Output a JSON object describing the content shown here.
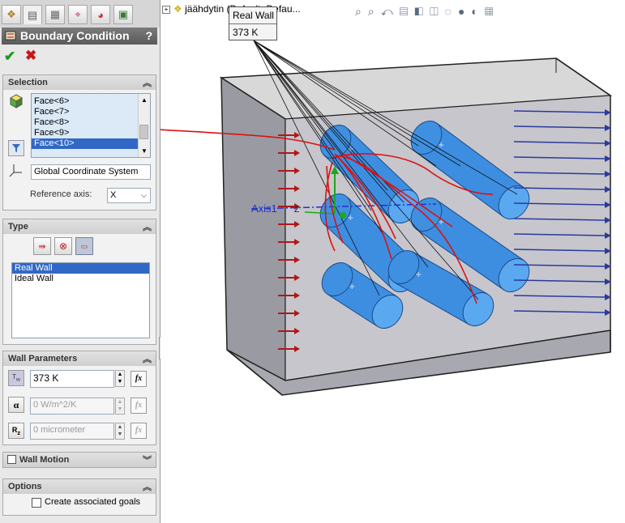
{
  "panel": {
    "title": "Boundary Condition",
    "help": "?",
    "tabs": [
      "feature-manager",
      "property-manager",
      "configuration-manager",
      "dimxpert-manager",
      "display-manager",
      "flow-analysis"
    ]
  },
  "selection": {
    "header": "Selection",
    "faces": [
      "Face<6>",
      "Face<7>",
      "Face<8>",
      "Face<9>",
      "Face<10>"
    ],
    "selected_face": "Face<10>",
    "coordinate_system": "Global Coordinate System",
    "reference_axis_label": "Reference axis:",
    "reference_axis_value": "X"
  },
  "type": {
    "header": "Type",
    "options": [
      "Real Wall",
      "Ideal Wall"
    ],
    "selected": "Real Wall"
  },
  "wall_parameters": {
    "header": "Wall Parameters",
    "temperature": "373 K",
    "heat_transfer_coefficient": "0 W/m^2/K",
    "roughness": "0 micrometer",
    "fx": "fx"
  },
  "wall_motion": {
    "header": "Wall Motion"
  },
  "options": {
    "header": "Options",
    "create_goals": "Create associated goals"
  },
  "viewport": {
    "tree_label": "jäähdytin  (Default<Defau...",
    "tooltip_name": "Real Wall",
    "tooltip_value": "373 K",
    "axis_label": "Axis1",
    "axis_letter": "Z"
  },
  "colors": {
    "accent_red": "#dd1111",
    "cylinder_blue": "#3d8ee0",
    "arrow_blue": "#2a3a9c",
    "arrow_red": "#b01818"
  }
}
